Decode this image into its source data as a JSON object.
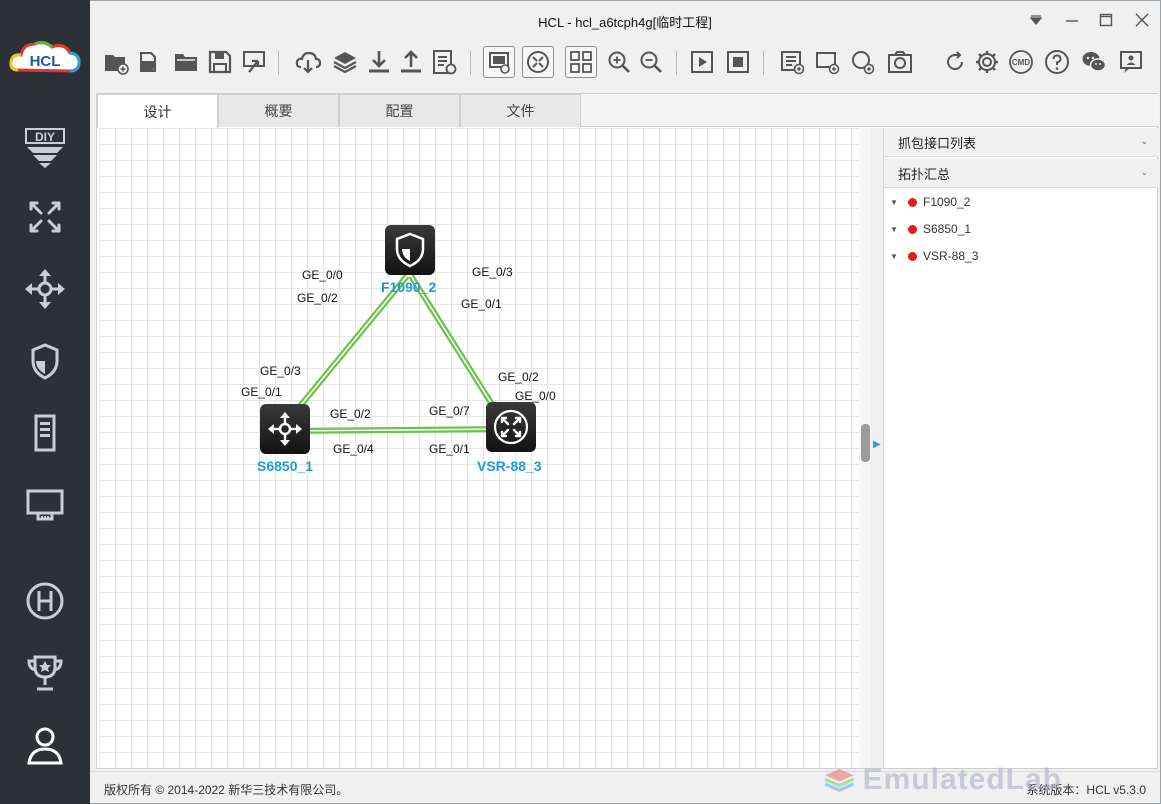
{
  "app": {
    "title": "HCL - hcl_a6tcph4g[临时工程]",
    "logo_text": "HCL"
  },
  "sidebar": {
    "items": [
      {
        "name": "diy",
        "label": "DIY"
      },
      {
        "name": "router",
        "label": ""
      },
      {
        "name": "switch",
        "label": ""
      },
      {
        "name": "firewall",
        "label": ""
      },
      {
        "name": "server",
        "label": ""
      },
      {
        "name": "host",
        "label": ""
      },
      {
        "name": "h3c",
        "label": ""
      },
      {
        "name": "trophy",
        "label": ""
      },
      {
        "name": "user",
        "label": ""
      }
    ]
  },
  "toolbar": {
    "icons": [
      "new-project",
      "open-project",
      "open-folder",
      "save",
      "export",
      "cloud",
      "layers",
      "download",
      "upload",
      "notes",
      "screen-view",
      "network-view",
      "grid-view",
      "zoom-in",
      "zoom-out",
      "start",
      "stop",
      "console-all",
      "add-rect",
      "add-ellipse",
      "snapshot",
      "refresh",
      "settings",
      "cmd",
      "help",
      "wechat",
      "feedback"
    ],
    "cmd_label": "CMD"
  },
  "tabs": [
    {
      "label": "设计",
      "active": true
    },
    {
      "label": "概要",
      "active": false
    },
    {
      "label": "配置",
      "active": false
    },
    {
      "label": "文件",
      "active": false
    }
  ],
  "right_panel": {
    "capture_header": "抓包接口列表",
    "topology_header": "拓扑汇总",
    "devices": [
      "F1090_2",
      "S6850_1",
      "VSR-88_3"
    ],
    "device_status_color": "#e31b1b"
  },
  "topology": {
    "nodes": [
      {
        "id": "F1090_2",
        "label": "F1090_2",
        "type": "firewall"
      },
      {
        "id": "S6850_1",
        "label": "S6850_1",
        "type": "switch"
      },
      {
        "id": "VSR-88_3",
        "label": "VSR-88_3",
        "type": "router"
      }
    ],
    "links": [
      {
        "a": "F1090_2",
        "b": "S6850_1",
        "a_ports": [
          "GE_0/0",
          "GE_0/2"
        ],
        "b_ports": [
          "GE_0/3",
          "GE_0/1"
        ]
      },
      {
        "a": "F1090_2",
        "b": "VSR-88_3",
        "a_ports": [
          "GE_0/3",
          "GE_0/1"
        ],
        "b_ports": [
          "GE_0/2",
          "GE_0/0"
        ]
      },
      {
        "a": "S6850_1",
        "b": "VSR-88_3",
        "a_ports": [
          "GE_0/2",
          "GE_0/4"
        ],
        "b_ports": [
          "GE_0/7",
          "GE_0/1"
        ]
      }
    ],
    "link_color": "#6cc24a",
    "label_color": "#1f9ad6"
  },
  "status": {
    "copyright": "版权所有 © 2014-2022 新华三技术有限公司。",
    "version": "系统版本：HCL v5.3.0"
  },
  "watermark": "EmulatedLab"
}
